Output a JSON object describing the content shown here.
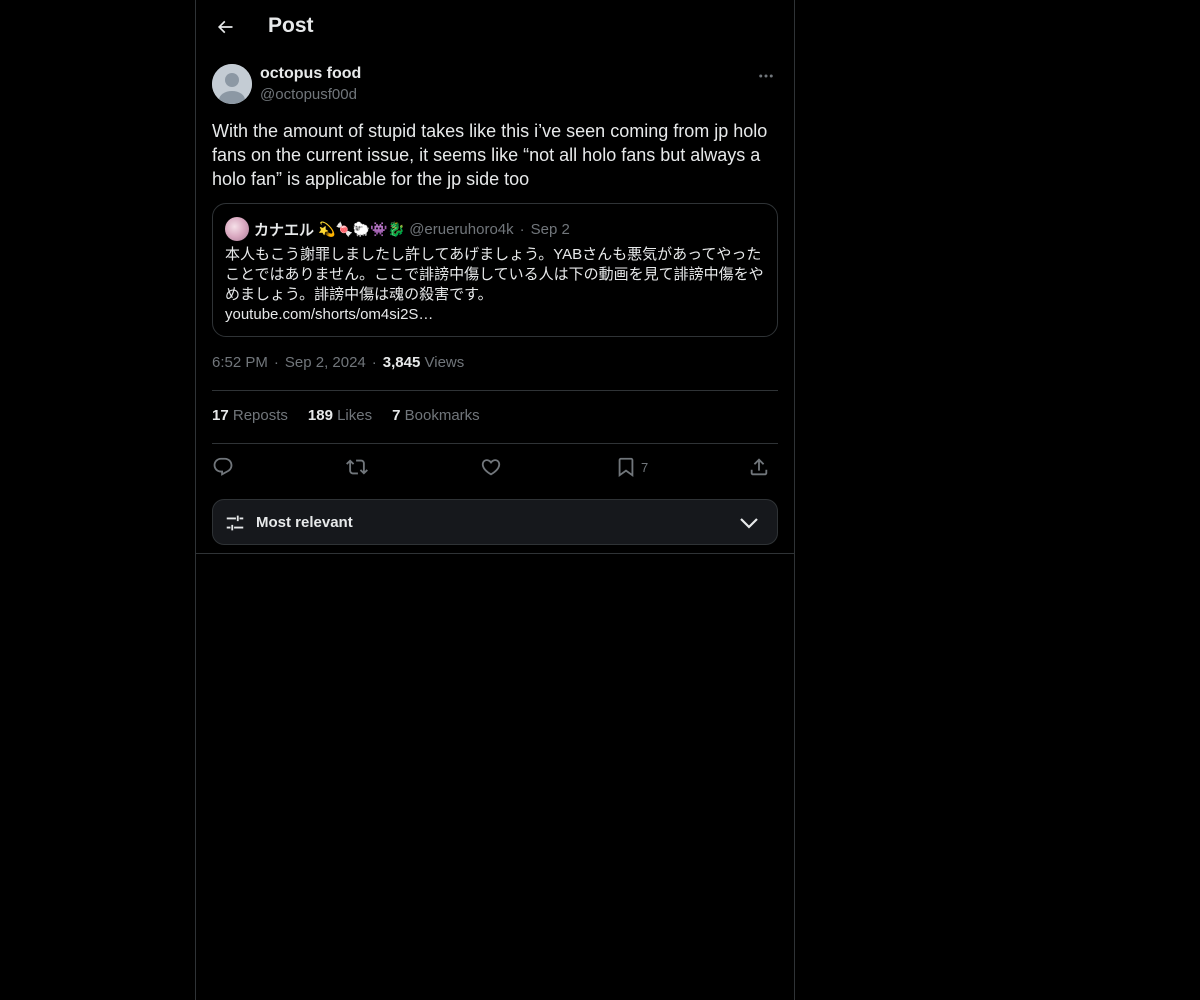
{
  "header": {
    "title": "Post",
    "back_icon": "arrow-left-icon"
  },
  "post": {
    "author_name": "octopus food",
    "author_handle": "@octopusf00d",
    "text": "With the amount of stupid takes like this i’ve seen coming from jp holo fans on the current issue, it seems like “not all holo fans but always a holo fan” is applicable for the jp side too",
    "time": "6:52 PM",
    "date": "Sep 2, 2024",
    "views_count": "3,845",
    "views_label": "Views"
  },
  "quote": {
    "name": "カナエル",
    "emojis": "💫🍬🐑👾🐉",
    "handle": "@erueruhoro4k",
    "date": "Sep 2",
    "text": "本人もこう謝罪しましたし許してあげましょう。YABさんも悪気があってやったことではありません。ここで誹謗中傷している人は下の動画を見て誹謗中傷をやめましょう。誹謗中傷は魂の殺害です。",
    "link": "youtube.com/shorts/om4si2S…"
  },
  "stats": {
    "reposts_count": "17",
    "reposts_label": "Reposts",
    "likes_count": "189",
    "likes_label": "Likes",
    "bookmarks_count": "7",
    "bookmarks_label": "Bookmarks"
  },
  "actions": {
    "reply_icon": "reply-icon",
    "repost_icon": "repost-icon",
    "like_icon": "heart-icon",
    "bookmark_icon": "bookmark-icon",
    "bookmark_count": "7",
    "share_icon": "share-icon"
  },
  "sort": {
    "label": "Most relevant"
  },
  "colors": {
    "background": "#000000",
    "text_primary": "#e7e9ea",
    "text_secondary": "#71767b",
    "border": "#2f3336"
  }
}
